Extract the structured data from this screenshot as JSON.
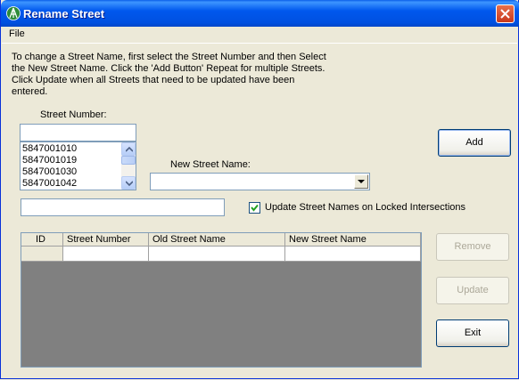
{
  "window": {
    "title": "Rename Street"
  },
  "menu": {
    "file": "File"
  },
  "instructions": "To change a Street Name, first select the Street Number and then Select the New Street Name.  Click the 'Add Button' Repeat for multiple Streets.  Click Update when all Streets that need to be updated have been entered.",
  "street_number": {
    "label": "Street Number:",
    "value": "",
    "items": [
      "5847001010",
      "5847001019",
      "5847001030",
      "5847001042"
    ]
  },
  "new_street_name": {
    "label": "New Street Name:",
    "value": ""
  },
  "extra_field": {
    "value": ""
  },
  "locked_checkbox": {
    "label": "Update Street Names on Locked Intersections",
    "checked": true
  },
  "grid": {
    "columns": [
      "ID",
      "Street Number",
      "Old Street Name",
      "New Street Name"
    ]
  },
  "buttons": {
    "add": "Add",
    "remove": "Remove",
    "update": "Update",
    "exit": "Exit"
  }
}
